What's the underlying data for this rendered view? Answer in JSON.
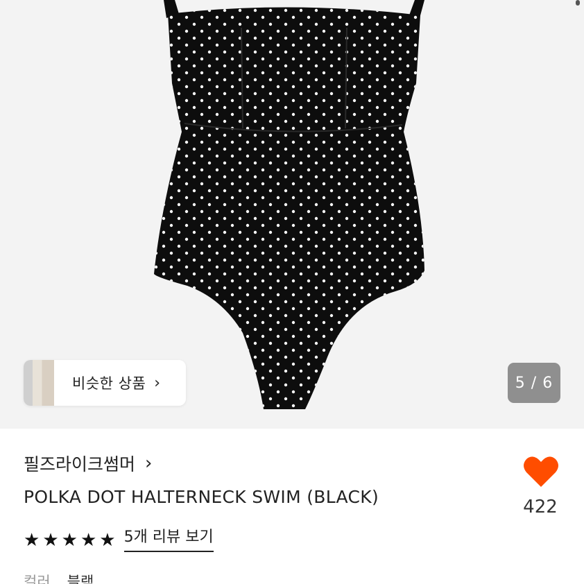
{
  "similar": {
    "label": "비슷한 상품",
    "chevron": "›",
    "thumb_icon": "product-thumbnail"
  },
  "gallery": {
    "counter": "5 / 6"
  },
  "product": {
    "brand": "필즈라이크썸머",
    "brand_chevron": "›",
    "title": "POLKA DOT HALTERNECK SWIM (BLACK)",
    "rating_stars": 5,
    "review_link": "5개 리뷰 보기",
    "likes": "422",
    "option_label": "컬러",
    "option_value": "블랙"
  },
  "colors": {
    "heart": "#ff4d00",
    "hero_bg": "#f3f3f3",
    "swimsuit": "#0d0d0d"
  }
}
